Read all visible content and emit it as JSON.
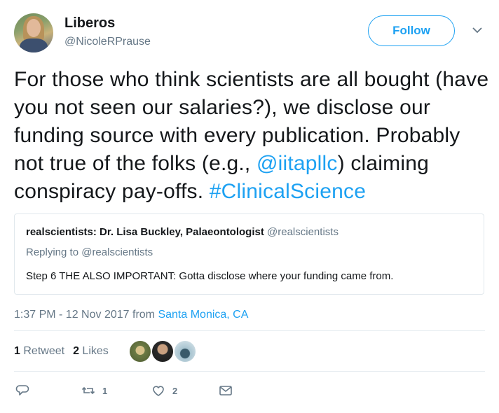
{
  "author": {
    "name": "Liberos",
    "handle": "@NicoleRPrause"
  },
  "header": {
    "follow_label": "Follow"
  },
  "tweet": {
    "text_parts": {
      "p1": "For those who think scientists are all bought (have you not seen our salaries?), we disclose our funding source with every publication. Probably not true of the folks (e.g., ",
      "mention": "@iitapllc",
      "p2": ") claiming conspiracy pay-offs. ",
      "hashtag": "#ClinicalScience"
    }
  },
  "quoted_tweet": {
    "author_name": "realscientists: Dr. Lisa Buckley, Palaeontologist",
    "author_handle": "@realscientists",
    "replying_to": "Replying to @realscientists",
    "text": "Step 6 THE ALSO IMPORTANT: Gotta disclose where your funding came from."
  },
  "meta": {
    "timestamp": "1:37 PM - 12 Nov 2017",
    "from_word": "from",
    "location": "Santa Monica, CA"
  },
  "stats": {
    "retweet_count": "1",
    "retweet_label": "Retweet",
    "like_count": "2",
    "like_label": "Likes"
  },
  "actions": {
    "reply_count": "",
    "retweet_count": "1",
    "like_count": "2"
  },
  "colors": {
    "accent": "#1da1f2",
    "secondary_text": "#657786",
    "primary_text": "#14171a",
    "border": "#e1e8ed"
  },
  "icons": {
    "caret": "chevron-down-icon",
    "reply": "reply-icon",
    "retweet": "retweet-icon",
    "like": "heart-icon",
    "dm": "envelope-icon"
  }
}
